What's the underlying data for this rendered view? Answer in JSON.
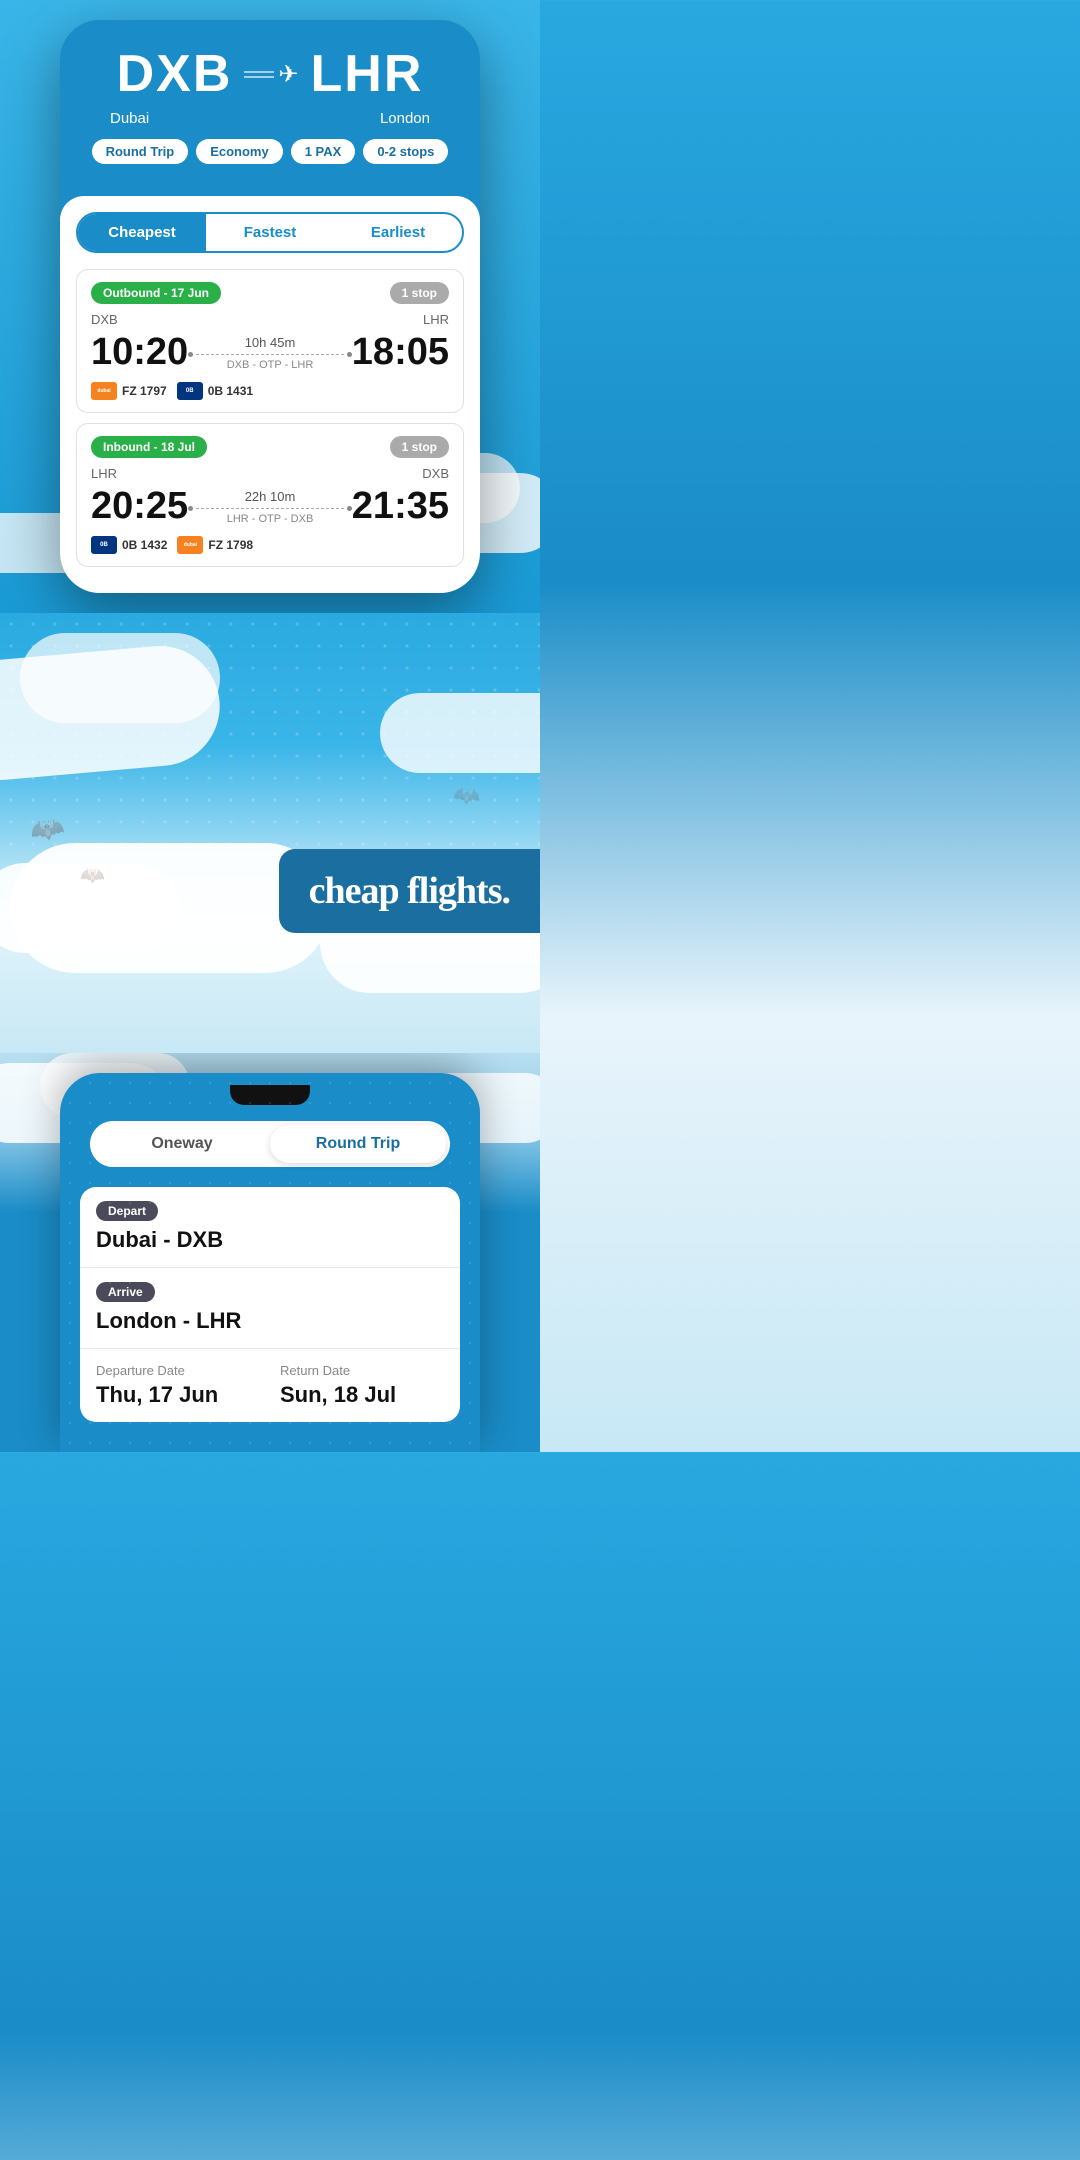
{
  "topPhone": {
    "origin": {
      "code": "DXB",
      "city": "Dubai"
    },
    "destination": {
      "code": "LHR",
      "city": "London"
    },
    "filters": {
      "tripType": "Round Trip",
      "cabin": "Economy",
      "pax": "1 PAX",
      "stops": "0-2 stops"
    },
    "tabs": {
      "cheapest": "Cheapest",
      "fastest": "Fastest",
      "earliest": "Earliest"
    },
    "outbound": {
      "label": "Outbound - 17 Jun",
      "stopBadge": "1 stop",
      "origin": "DXB",
      "destination": "LHR",
      "departTime": "10:20",
      "arriveTime": "18:05",
      "duration": "10h 45m",
      "route": "DXB - OTP - LHR",
      "airline1": {
        "code": "FZ 1797",
        "logoText": "dubai"
      },
      "airline2": {
        "code": "0B 1431",
        "logoText": "0B"
      }
    },
    "inbound": {
      "label": "Inbound - 18 Jul",
      "stopBadge": "1 stop",
      "origin": "LHR",
      "destination": "DXB",
      "departTime": "20:25",
      "arriveTime": "21:35",
      "duration": "22h 10m",
      "route": "LHR - OTP - DXB",
      "airline1": {
        "code": "0B 1432",
        "logoText": "0B"
      },
      "airline2": {
        "code": "FZ 1798",
        "logoText": "dubai"
      }
    }
  },
  "headline": {
    "text": "cheap flights."
  },
  "bottomPhone": {
    "toggle": {
      "oneway": "Oneway",
      "roundTrip": "Round Trip"
    },
    "depart": {
      "label": "Depart",
      "value": "Dubai - DXB"
    },
    "arrive": {
      "label": "Arrive",
      "value": "London - LHR"
    },
    "departureDate": {
      "label": "Departure Date",
      "value": "Thu, 17 Jun"
    },
    "returnDate": {
      "label": "Return Date",
      "value": "Sun, 18 Jul"
    }
  }
}
